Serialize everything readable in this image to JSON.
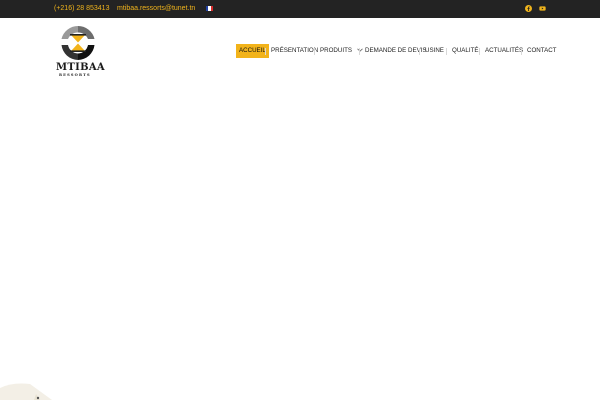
{
  "topbar": {
    "phone": "(+216) 28 853413",
    "email": "mtibaa.ressorts@tunet.tn",
    "language_flag": "fr-flag-icon",
    "social": [
      "facebook-icon",
      "youtube-icon"
    ]
  },
  "logo": {
    "brand": "MTIBAA",
    "sub": "RESSORTS"
  },
  "nav": {
    "items": [
      {
        "label": "ACCUEIL",
        "active": true
      },
      {
        "label": "PRÉSENTATION"
      },
      {
        "label": "PRODUITS",
        "has_dropdown": true
      },
      {
        "label": "DEMANDE DE DEVIS"
      },
      {
        "label": "USINE"
      },
      {
        "label": "QUALITÉ"
      },
      {
        "label": "ACTUALITÉS"
      },
      {
        "label": "CONTACT"
      }
    ]
  },
  "colors": {
    "accent": "#f2b31a",
    "topbar_bg": "#232323",
    "topbar_text": "#f0b41c"
  }
}
